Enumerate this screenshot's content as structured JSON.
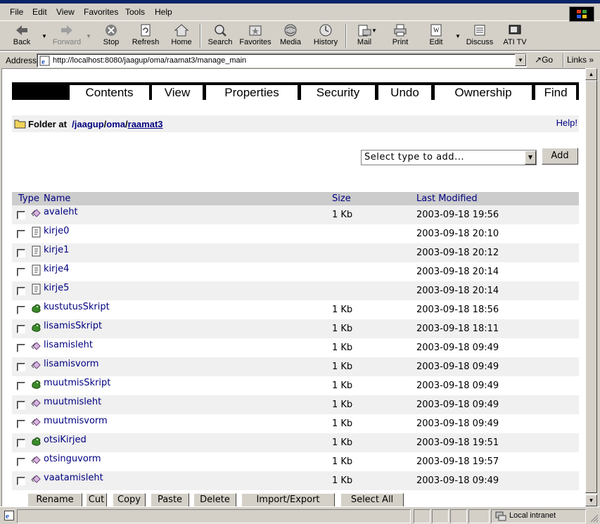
{
  "browser": {
    "menu": [
      "File",
      "Edit",
      "View",
      "Favorites",
      "Tools",
      "Help"
    ],
    "toolbar": {
      "back": "Back",
      "forward": "Forward",
      "stop": "Stop",
      "refresh": "Refresh",
      "home": "Home",
      "search": "Search",
      "favorites": "Favorites",
      "media": "Media",
      "history": "History",
      "mail": "Mail",
      "print": "Print",
      "edit": "Edit",
      "discuss": "Discuss",
      "ati": "ATI TV"
    },
    "address_label": "Address",
    "address_url": "http://localhost:8080/jaagup/oma/raamat3/manage_main",
    "go_label": "Go",
    "links_label": "Links",
    "status_zone": "Local intranet"
  },
  "zmi": {
    "tabs": [
      "Contents",
      "View",
      "Properties",
      "Security",
      "Undo",
      "Ownership",
      "Find"
    ],
    "active_tab": "Contents",
    "location": {
      "prefix": "Folder at",
      "path": [
        "/jaagup",
        "/",
        "oma",
        "/",
        "raamat3"
      ]
    },
    "help": "Help!",
    "add_select_placeholder": "Select type to add...",
    "add_button": "Add",
    "columns": {
      "type": "Type",
      "name": "Name",
      "size": "Size",
      "modified": "Last Modified"
    },
    "items": [
      {
        "icon": "dtml-method-icon",
        "name": "avaleht",
        "size": "1 Kb",
        "modified": "2003-09-18 19:56"
      },
      {
        "icon": "dtml-document-icon",
        "name": "kirje0",
        "size": "",
        "modified": "2003-09-18 20:10"
      },
      {
        "icon": "dtml-document-icon",
        "name": "kirje1",
        "size": "",
        "modified": "2003-09-18 20:12"
      },
      {
        "icon": "dtml-document-icon",
        "name": "kirje4",
        "size": "",
        "modified": "2003-09-18 20:14"
      },
      {
        "icon": "dtml-document-icon",
        "name": "kirje5",
        "size": "",
        "modified": "2003-09-18 20:14"
      },
      {
        "icon": "python-script-icon",
        "name": "kustutusSkript",
        "size": "1 Kb",
        "modified": "2003-09-18 18:56"
      },
      {
        "icon": "python-script-icon",
        "name": "lisamisSkript",
        "size": "1 Kb",
        "modified": "2003-09-18 18:11"
      },
      {
        "icon": "dtml-method-icon",
        "name": "lisamisleht",
        "size": "1 Kb",
        "modified": "2003-09-18 09:49"
      },
      {
        "icon": "dtml-method-icon",
        "name": "lisamisvorm",
        "size": "1 Kb",
        "modified": "2003-09-18 09:49"
      },
      {
        "icon": "python-script-icon",
        "name": "muutmisSkript",
        "size": "1 Kb",
        "modified": "2003-09-18 09:49"
      },
      {
        "icon": "dtml-method-icon",
        "name": "muutmisleht",
        "size": "1 Kb",
        "modified": "2003-09-18 09:49"
      },
      {
        "icon": "dtml-method-icon",
        "name": "muutmisvorm",
        "size": "1 Kb",
        "modified": "2003-09-18 09:49"
      },
      {
        "icon": "python-script-icon",
        "name": "otsiKirjed",
        "size": "1 Kb",
        "modified": "2003-09-18 19:51"
      },
      {
        "icon": "dtml-method-icon",
        "name": "otsinguvorm",
        "size": "1 Kb",
        "modified": "2003-09-18 19:57"
      },
      {
        "icon": "dtml-method-icon",
        "name": "vaatamisleht",
        "size": "1 Kb",
        "modified": "2003-09-18 09:49"
      }
    ],
    "actions": [
      "Rename",
      "Cut",
      "Copy",
      "Paste",
      "Delete",
      "Import/Export",
      "Select All"
    ]
  },
  "colors": {
    "link": "#000080",
    "header_bg": "#cccccc",
    "row_alt_bg": "#f0f0f0",
    "tab_bar": "#000000",
    "chrome": "#d4d0c8"
  }
}
